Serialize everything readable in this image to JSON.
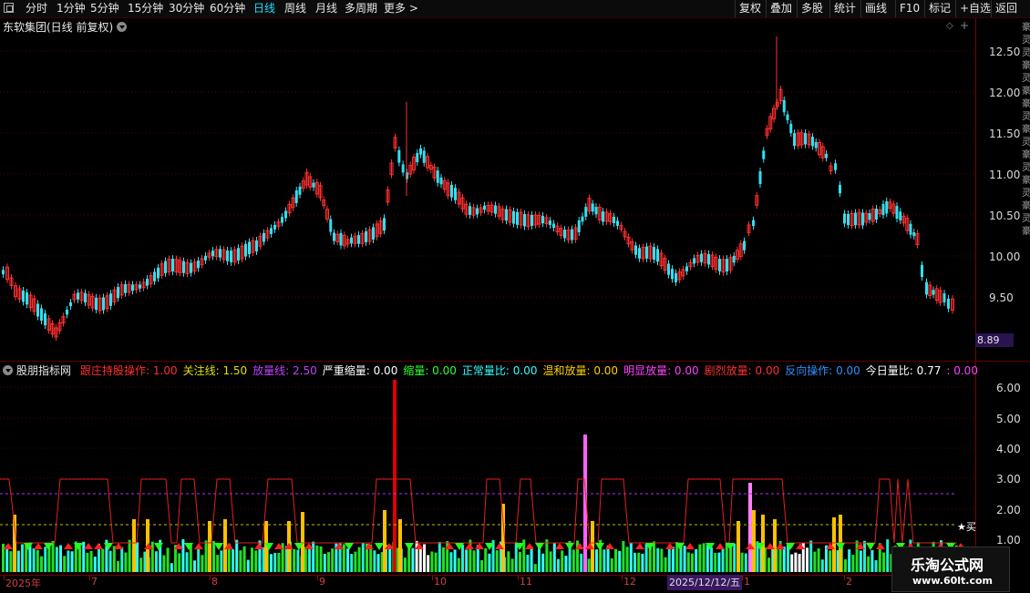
{
  "toolbar": {
    "periods": [
      "分时",
      "1分钟",
      "5分钟",
      "15分钟",
      "30分钟",
      "60分钟",
      "日线",
      "周线",
      "月线",
      "多周期",
      "更多 >"
    ],
    "active_period": "日线",
    "right_buttons": [
      "复权",
      "叠加",
      "多股",
      "统计",
      "画线",
      "F10",
      "标记",
      "+自选",
      "返回"
    ]
  },
  "chart_title": "东软集团(日线 前复权)",
  "price_axis": [
    "12.50",
    "12.00",
    "11.50",
    "11.00",
    "10.50",
    "10.00",
    "9.50"
  ],
  "last_price_tag": "8.89",
  "indicator": {
    "name": "股朋指标网",
    "items": [
      {
        "label": "跟庄持股操作: 1.00",
        "color": "#ff3030"
      },
      {
        "label": "关注线: 1.50",
        "color": "#e0e000"
      },
      {
        "label": "放量线: 2.50",
        "color": "#c040ff"
      },
      {
        "label": "严重缩量: 0.00",
        "color": "#ffffff"
      },
      {
        "label": "缩量: 0.00",
        "color": "#30ff30"
      },
      {
        "label": "正常量比: 0.00",
        "color": "#30ffff"
      },
      {
        "label": "温和放量: 0.00",
        "color": "#ffd000"
      },
      {
        "label": "明显放量: 0.00",
        "color": "#ff40ff"
      },
      {
        "label": "剧烈放量: 0.00",
        "color": "#ff3030"
      },
      {
        "label": "反向操作: 0.00",
        "color": "#3090ff"
      },
      {
        "label": "今日量比: 0.77",
        "color": "#ffffff"
      },
      {
        "label": ": 0.00",
        "color": "#ff40ff"
      }
    ],
    "axis": [
      "6.00",
      "5.00",
      "4.00",
      "3.00",
      "2.00",
      "1.00"
    ]
  },
  "buy_label": "★买",
  "dates": [
    "2025年",
    "7",
    "8",
    "9",
    "10",
    "11",
    "12",
    "1",
    "2"
  ],
  "highlight_date": "2025/12/12/五",
  "side_text": "豪灵灵豪灵豪豪灵豪灵豪灵豪灵豪灵豪",
  "watermark": {
    "line1": "乐淘公式网",
    "line2": "www.60lt.com"
  },
  "colors": {
    "up": "#ff3030",
    "down": "#30e0f0",
    "grid": "#7a0000"
  }
}
